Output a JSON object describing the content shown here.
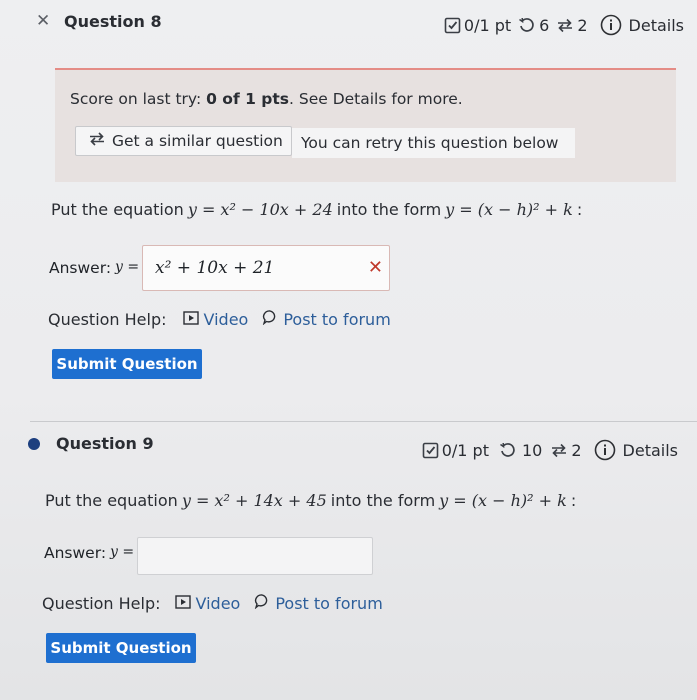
{
  "q8": {
    "close_glyph": "✕",
    "title": "Question 8",
    "points": "0/1 pt",
    "retries": "6",
    "attempts": "2",
    "details": "Details",
    "score_label": "Score on last try:",
    "score_value": "0 of 1 pts",
    "score_suffix": ". See Details for more.",
    "similar_label": "Get a similar question",
    "retry_text": "You can retry this question below",
    "prompt_before": "Put the equation",
    "prompt_mid": "into the form",
    "equation": "y = x² − 10x + 24",
    "form": "y = (x − h)² + k",
    "answer_label": "Answer:",
    "answer_var": "y =",
    "answer_value": "x² + 10x + 21",
    "help_label": "Question Help:",
    "video_label": "Video",
    "forum_label": "Post to forum",
    "submit_label": "Submit Question"
  },
  "q9": {
    "title": "Question 9",
    "points": "0/1 pt",
    "retries": "10",
    "attempts": "2",
    "details": "Details",
    "prompt_before": "Put the equation",
    "prompt_mid": "into the form",
    "equation": "y = x² + 14x + 45",
    "form": "y = (x − h)² + k",
    "answer_label": "Answer:",
    "answer_var": "y =",
    "answer_value": "",
    "help_label": "Question Help:",
    "video_label": "Video",
    "forum_label": "Post to forum",
    "submit_label": "Submit Question"
  },
  "colors": {
    "accent": "#1e6fd0",
    "error": "#c0392b",
    "link": "#2d5e9a",
    "bullet": "#1d3f7f"
  },
  "icons": [
    "close-icon",
    "score-check-icon",
    "retry-icon",
    "similar-icon",
    "info-icon",
    "video-icon",
    "forum-icon",
    "current-question-bullet"
  ]
}
